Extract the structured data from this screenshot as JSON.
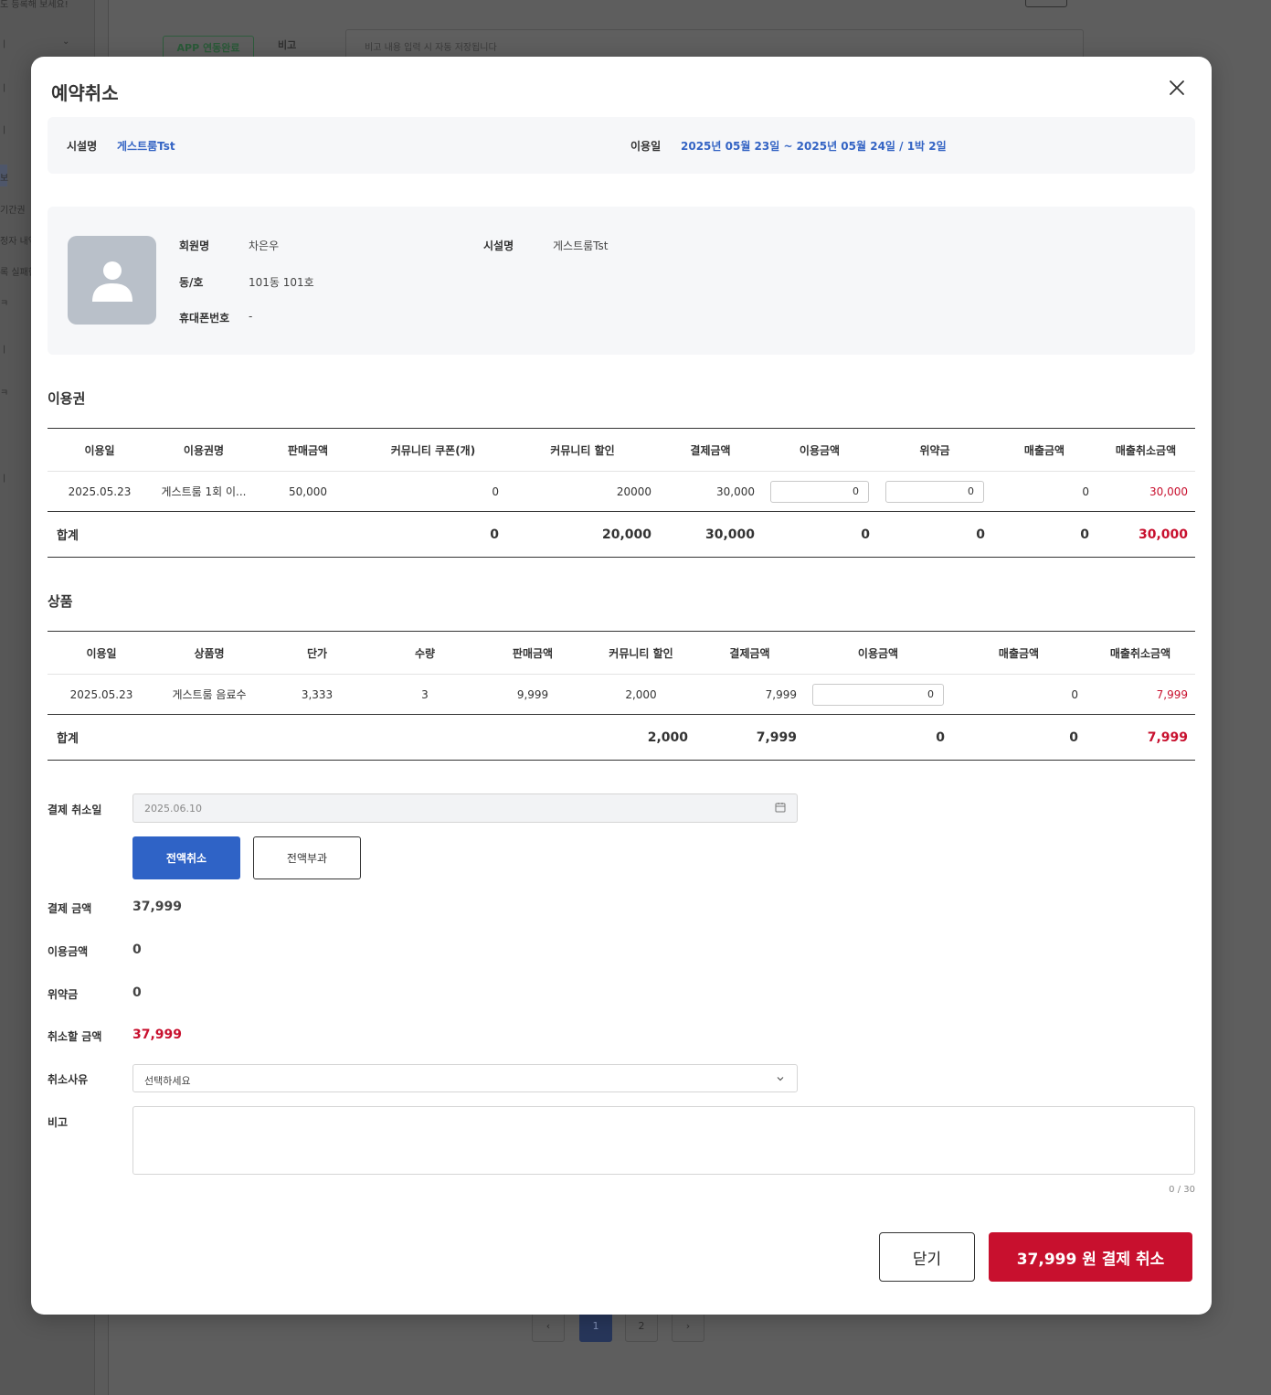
{
  "background": {
    "top_text": "도 등록해 보세요!",
    "sidebar_items": [
      "ㅣ",
      "ㅣ",
      "ㅣ",
      "보",
      "기간권",
      "정자 내역",
      "록 실패현",
      "ㅋ",
      "ㅣ",
      "ㅋ",
      "ㅣ"
    ],
    "badge": "APP 연동완료",
    "note_label": "비고",
    "note_placeholder": "비고 내용 입력 시 자동 저장됩니다",
    "pager": [
      "‹",
      "1",
      "2",
      "›"
    ]
  },
  "modal": {
    "title": "예약취소",
    "facility": {
      "name_label": "시설명",
      "name_value": "게스트룸Tst",
      "date_label": "이용일",
      "date_value": "2025년 05월 23일 ~ 2025년 05월 24일 / 1박 2일"
    },
    "member": {
      "name_label": "회원명",
      "name_value": "차은우",
      "unit_label": "동/호",
      "unit_value": "101동 101호",
      "phone_label": "휴대폰번호",
      "phone_value": "-",
      "facility_label": "시설명",
      "facility_value": "게스트룸Tst"
    },
    "ticket_section": {
      "title": "이용권",
      "headers": [
        "이용일",
        "이용권명",
        "판매금액",
        "커뮤니티 쿠폰(개)",
        "커뮤니티 할인",
        "결제금액",
        "이용금액",
        "위약금",
        "매출금액",
        "매출취소금액"
      ],
      "row": {
        "date": "2025.05.23",
        "name": "게스트룸 1회 이...",
        "sale": "50,000",
        "coupon": "0",
        "discount": "20000",
        "paid": "30,000",
        "usage_input": "0",
        "penalty_input": "0",
        "revenue": "0",
        "cancel": "30,000"
      },
      "total": {
        "label": "합계",
        "coupon": "0",
        "discount": "20,000",
        "paid": "30,000",
        "usage": "0",
        "penalty": "0",
        "revenue": "0",
        "cancel": "30,000"
      }
    },
    "product_section": {
      "title": "상품",
      "headers": [
        "이용일",
        "상품명",
        "단가",
        "수량",
        "판매금액",
        "커뮤니티 할인",
        "결제금액",
        "이용금액",
        "매출금액",
        "매출취소금액"
      ],
      "row": {
        "date": "2025.05.23",
        "name": "게스트룸 음료수",
        "unit_price": "3,333",
        "qty": "3",
        "sale": "9,999",
        "discount": "2,000",
        "paid": "7,999",
        "usage_input": "0",
        "revenue": "0",
        "cancel": "7,999"
      },
      "total": {
        "label": "합계",
        "discount": "2,000",
        "paid": "7,999",
        "usage": "0",
        "revenue": "0",
        "cancel": "7,999"
      }
    },
    "form": {
      "cancel_date_label": "결제 취소일",
      "cancel_date_value": "2025.06.10",
      "full_cancel_btn": "전액취소",
      "full_charge_btn": "전액부과",
      "pay_amount_label": "결제 금액",
      "pay_amount_value": "37,999",
      "usage_label": "이용금액",
      "usage_value": "0",
      "penalty_label": "위약금",
      "penalty_value": "0",
      "refund_label": "취소할 금액",
      "refund_value": "37,999",
      "reason_label": "취소사유",
      "reason_value": "선택하세요",
      "note_label": "비고",
      "note_value": "",
      "counter": "0 / 30"
    },
    "footer": {
      "close_btn": "닫기",
      "cancel_btn": "37,999 원 결제 취소"
    }
  },
  "colors": {
    "accent_blue": "#2f63c6",
    "link_blue": "#3464c4",
    "danger_red": "#c8102e"
  }
}
